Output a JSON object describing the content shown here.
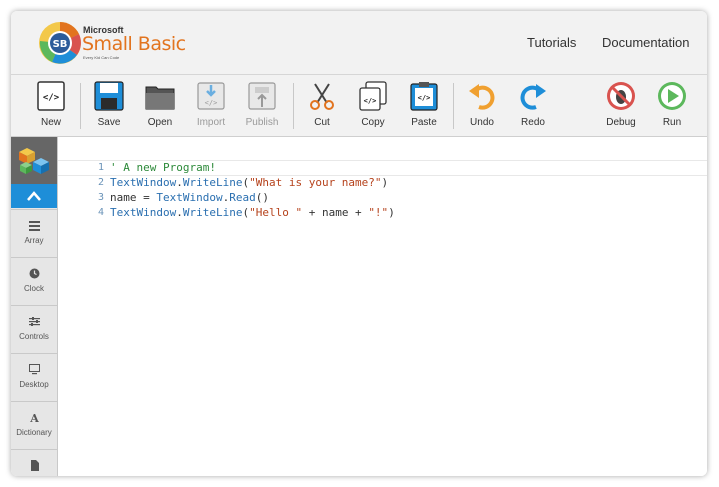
{
  "header": {
    "brand_small": "Microsoft",
    "brand_main": "Small Basic",
    "brand_tagline": "Every Kid Can Code",
    "nav": [
      {
        "label": "Tutorials"
      },
      {
        "label": "Documentation"
      }
    ]
  },
  "toolbar": {
    "new_label": "New",
    "save_label": "Save",
    "open_label": "Open",
    "import_label": "Import",
    "publish_label": "Publish",
    "cut_label": "Cut",
    "copy_label": "Copy",
    "paste_label": "Paste",
    "undo_label": "Undo",
    "redo_label": "Redo",
    "debug_label": "Debug",
    "run_label": "Run"
  },
  "sidebar": {
    "items": [
      {
        "label": "Array",
        "icon": "list-icon"
      },
      {
        "label": "Clock",
        "icon": "clock-icon"
      },
      {
        "label": "Controls",
        "icon": "sliders-icon"
      },
      {
        "label": "Desktop",
        "icon": "monitor-icon"
      },
      {
        "label": "Dictionary",
        "icon": "letter-a-icon"
      },
      {
        "label": "",
        "icon": "file-icon"
      }
    ]
  },
  "editor": {
    "lines": [
      {
        "num": "1",
        "tokens": [
          {
            "t": "' A new Program!",
            "k": "comment"
          }
        ]
      },
      {
        "num": "2",
        "tokens": [
          {
            "t": "TextWindow",
            "k": "type"
          },
          {
            "t": ".",
            "k": "plain"
          },
          {
            "t": "WriteLine",
            "k": "type"
          },
          {
            "t": "(",
            "k": "plain"
          },
          {
            "t": "\"What is your name?\"",
            "k": "str"
          },
          {
            "t": ")",
            "k": "plain"
          }
        ]
      },
      {
        "num": "3",
        "tokens": [
          {
            "t": "name = ",
            "k": "plain"
          },
          {
            "t": "TextWindow",
            "k": "type"
          },
          {
            "t": ".",
            "k": "plain"
          },
          {
            "t": "Read",
            "k": "type"
          },
          {
            "t": "()",
            "k": "plain"
          }
        ]
      },
      {
        "num": "4",
        "tokens": [
          {
            "t": "TextWindow",
            "k": "type"
          },
          {
            "t": ".",
            "k": "plain"
          },
          {
            "t": "WriteLine",
            "k": "type"
          },
          {
            "t": "(",
            "k": "plain"
          },
          {
            "t": "\"Hello \"",
            "k": "str"
          },
          {
            "t": " + name + ",
            "k": "plain"
          },
          {
            "t": "\"!\"",
            "k": "str"
          },
          {
            "t": ")",
            "k": "plain"
          }
        ]
      }
    ]
  },
  "colors": {
    "accent": "#1e8ed8",
    "brand_orange": "#e2741f",
    "run_green": "#5cb85c",
    "debug_red": "#d9534f",
    "undo_orange": "#f0a030"
  }
}
